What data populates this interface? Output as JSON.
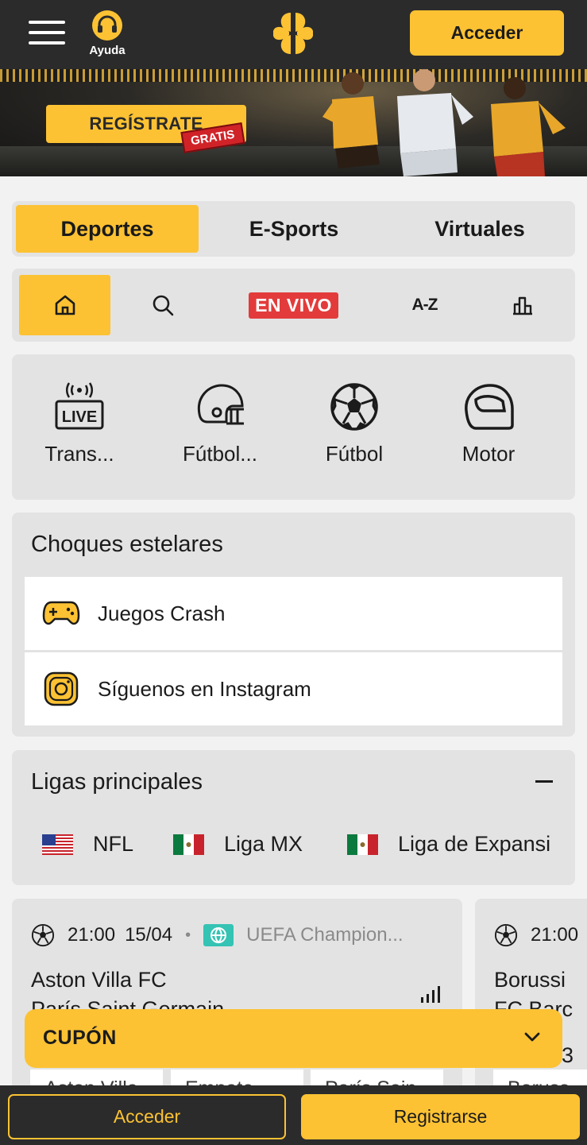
{
  "header": {
    "help_label": "Ayuda",
    "login_label": "Acceder",
    "icons": [
      "menu-icon",
      "headset-icon",
      "clover-logo"
    ]
  },
  "banner": {
    "register_label": "REGÍSTRATE",
    "badge_label": "GRATIS"
  },
  "tabs": [
    {
      "label": "Deportes",
      "active": true
    },
    {
      "label": "E-Sports",
      "active": false
    },
    {
      "label": "Virtuales",
      "active": false
    }
  ],
  "quicknav": {
    "items": [
      "home-icon",
      "search-icon",
      "EN VIVO",
      "A-Z",
      "stats-icon"
    ],
    "live_label": "EN VIVO",
    "az_label": "A-Z"
  },
  "sports": [
    {
      "label": "Trans...",
      "icon": "live-broadcast-icon"
    },
    {
      "label": "Fútbol...",
      "icon": "american-football-helmet-icon"
    },
    {
      "label": "Fútbol",
      "icon": "soccer-ball-icon"
    },
    {
      "label": "Motor",
      "icon": "racing-helmet-icon"
    }
  ],
  "choques": {
    "title": "Choques estelares",
    "items": [
      {
        "label": "Juegos Crash",
        "icon": "gamepad-icon"
      },
      {
        "label": "Síguenos en Instagram",
        "icon": "instagram-icon"
      }
    ]
  },
  "ligas": {
    "title": "Ligas principales",
    "items": [
      {
        "label": "NFL",
        "flag": "usa"
      },
      {
        "label": "Liga MX",
        "flag": "mexico"
      },
      {
        "label": "Liga de Expansi",
        "flag": "mexico"
      }
    ]
  },
  "matches": [
    {
      "time": "21:00",
      "date": "15/04",
      "competition": "UEFA Champion...",
      "home": "Aston Villa FC",
      "away": "París Saint Germain",
      "odds": [
        "Aston Villa",
        "Empate",
        "París Sain"
      ]
    },
    {
      "time": "21:00",
      "home": "Borussi",
      "away": "FC Barc",
      "odds": [
        "Boruss"
      ],
      "partial_digit": "3"
    }
  ],
  "coupon": {
    "label": "CUPÓN"
  },
  "bottom": {
    "login_label": "Acceder",
    "register_label": "Registrarse"
  },
  "colors": {
    "accent": "#fcc233",
    "dark": "#2b2b2b",
    "live": "#e33b3b",
    "panel": "#e3e3e3"
  }
}
